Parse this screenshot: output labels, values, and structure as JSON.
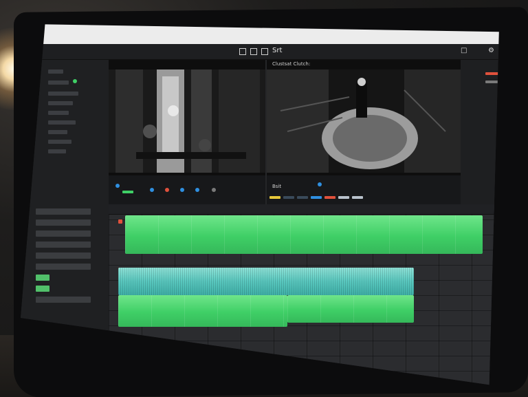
{
  "scene": {
    "description_free": true,
    "colors": {
      "clip_green": "#3fcf66",
      "clip_teal": "#59c8bf",
      "accent_red": "#e0513c",
      "accent_blue": "#2f8fe0",
      "accent_yellow": "#e7c83a"
    }
  },
  "menubar": {
    "title": "Srt"
  },
  "viewers": {
    "program_label": "Clustsat Clutch:",
    "program_timecode": "Bsit"
  },
  "icons": {
    "window_controls": [
      "square-icon",
      "square-icon",
      "square-icon"
    ],
    "top_right": [
      "minimize-icon",
      "settings-icon"
    ],
    "transport": [
      "play-icon",
      "record-icon",
      "stop-icon"
    ]
  }
}
